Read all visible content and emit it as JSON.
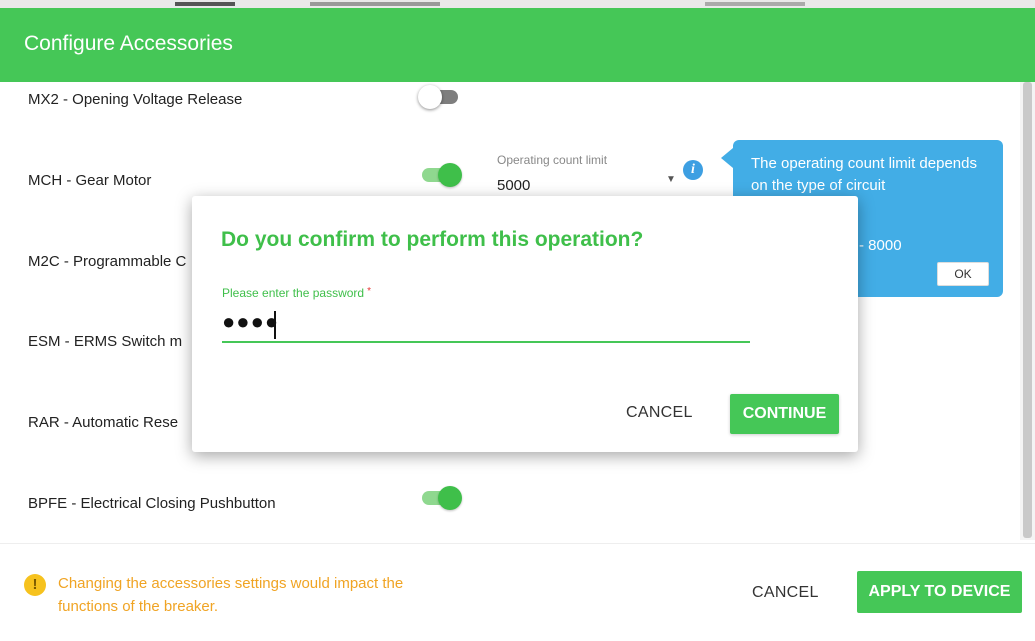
{
  "header": {
    "title": "Configure Accessories"
  },
  "accessories": [
    {
      "label": "MX2 - Opening Voltage Release",
      "enabled": false
    },
    {
      "label": "MCH - Gear Motor",
      "enabled": true
    },
    {
      "label": "M2C - Programmable C",
      "enabled": null
    },
    {
      "label": "ESM - ERMS Switch m",
      "enabled": null
    },
    {
      "label": "RAR - Automatic Rese",
      "enabled": null
    },
    {
      "label": "BPFE - Electrical Closing Pushbutton",
      "enabled": true
    }
  ],
  "operating_count": {
    "label": "Operating count limit",
    "value": "5000"
  },
  "tooltip": {
    "text": "The operating count limit depends on the type of circuit",
    "range_text": "- 8000",
    "ok_label": "OK"
  },
  "dialog": {
    "title": "Do you confirm to perform this operation?",
    "password_label": "Please enter the password",
    "required_mark": "*",
    "password_value": "●●●●",
    "cancel_label": "CANCEL",
    "continue_label": "CONTINUE"
  },
  "footer": {
    "warning_text": "Changing the accessories settings would impact the functions of the breaker.",
    "cancel_label": "CANCEL",
    "apply_label": "APPLY TO DEVICE"
  },
  "colors": {
    "primary_green": "#45c757",
    "info_blue": "#42ade6",
    "warning_orange": "#f0a424",
    "required_red": "#e53935"
  },
  "icons": {
    "info": "info-icon",
    "warning": "warning-icon"
  }
}
